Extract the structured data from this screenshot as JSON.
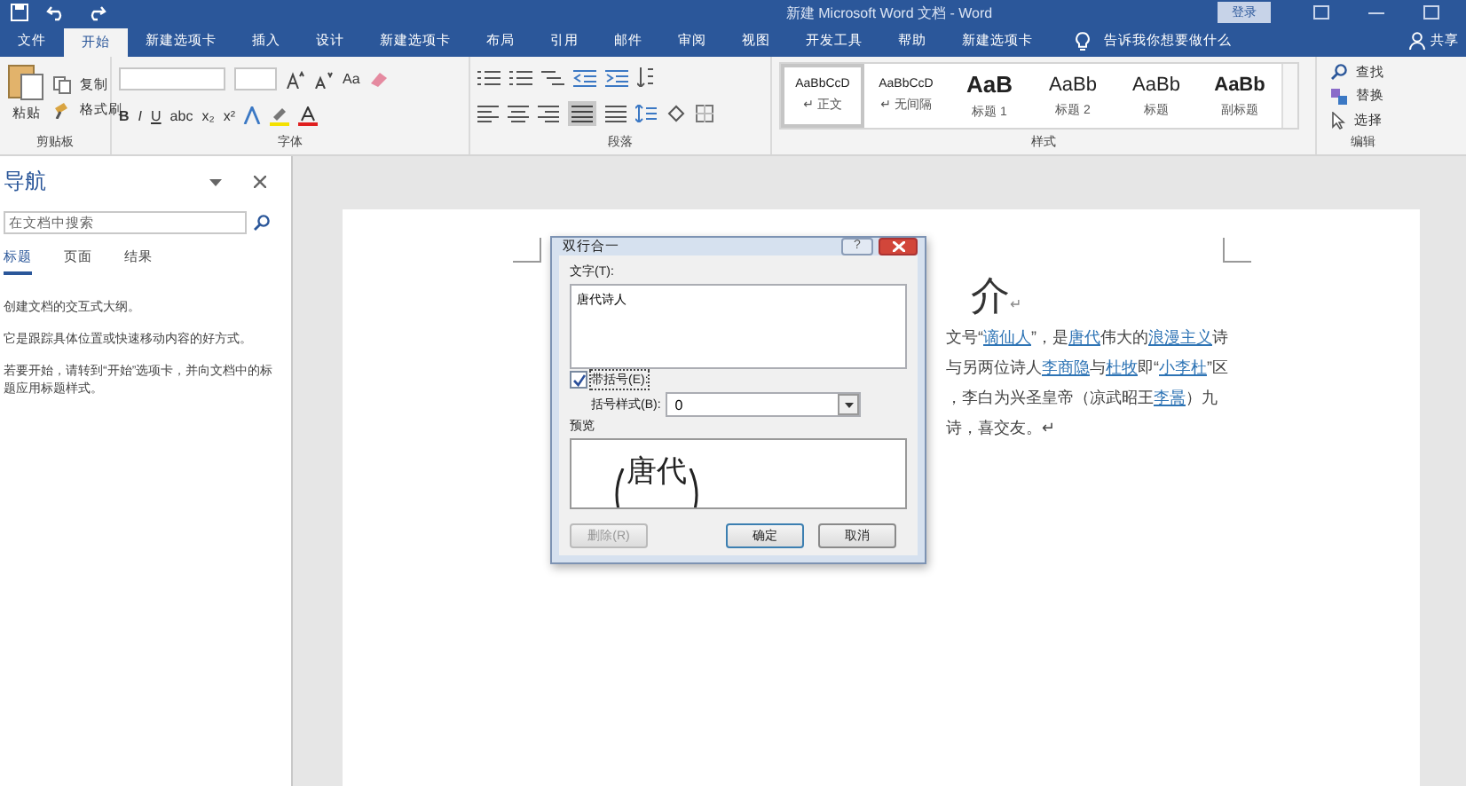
{
  "title_bar": {
    "title": "新建 Microsoft Word 文档 - Word",
    "sign_in": "登录"
  },
  "tabs": [
    {
      "label": "文件",
      "selected": false
    },
    {
      "label": "开始",
      "selected": true
    },
    {
      "label": "新建选项卡",
      "selected": false
    },
    {
      "label": "插入",
      "selected": false
    },
    {
      "label": "设计",
      "selected": false
    },
    {
      "label": "新建选项卡",
      "selected": false
    },
    {
      "label": "布局",
      "selected": false
    },
    {
      "label": "引用",
      "selected": false
    },
    {
      "label": "邮件",
      "selected": false
    },
    {
      "label": "审阅",
      "selected": false
    },
    {
      "label": "视图",
      "selected": false
    },
    {
      "label": "开发工具",
      "selected": false
    },
    {
      "label": "帮助",
      "selected": false
    },
    {
      "label": "新建选项卡",
      "selected": false
    }
  ],
  "tell_me": "告诉我你想要做什么",
  "share": "共享",
  "ribbon": {
    "clipboard": {
      "paste": "粘贴",
      "copy": "复制",
      "format_painter": "格式刷",
      "label": "剪贴板"
    },
    "font": {
      "change_case": "Aa",
      "format_buttons": [
        "B",
        "I",
        "U",
        "abc",
        "x₂",
        "x²"
      ],
      "label": "字体"
    },
    "paragraph": {
      "label": "段落"
    },
    "styles": {
      "label": "样式",
      "items": [
        {
          "preview": "AaBbCcD",
          "name": "↵ 正文",
          "kind": "normal",
          "selected": true
        },
        {
          "preview": "AaBbCcD",
          "name": "↵ 无间隔",
          "kind": "normal",
          "selected": false
        },
        {
          "preview": "AaB",
          "name": "标题 1",
          "kind": "h1",
          "selected": false
        },
        {
          "preview": "AaBb",
          "name": "标题 2",
          "kind": "h2",
          "selected": false
        },
        {
          "preview": "AaBb",
          "name": "标题",
          "kind": "title",
          "selected": false
        },
        {
          "preview": "AaBb",
          "name": "副标题",
          "kind": "subtitle",
          "selected": false
        }
      ]
    },
    "editing": {
      "find": "查找",
      "replace": "替换",
      "select": "选择",
      "label": "编辑"
    }
  },
  "nav": {
    "title": "导航",
    "search_placeholder": "在文档中搜索",
    "tabs": [
      {
        "label": "标题",
        "selected": true
      },
      {
        "label": "页面",
        "selected": false
      },
      {
        "label": "结果",
        "selected": false
      }
    ],
    "paragraphs": [
      "创建文档的交互式大纲。",
      "它是跟踪具体位置或快速移动内容的好方式。",
      "若要开始，请转到“开始”选项卡，并向文档中的标题应用标题样式。"
    ]
  },
  "document": {
    "heading": "介",
    "heading_mark": "↵",
    "lines": [
      {
        "parts": [
          {
            "text": "文号“",
            "link": false
          },
          {
            "text": "谪仙人",
            "link": true
          },
          {
            "text": "”，是",
            "link": false
          },
          {
            "text": "唐代",
            "link": true
          },
          {
            "text": "伟大的",
            "link": false
          },
          {
            "text": "浪漫主义",
            "link": true
          },
          {
            "text": "诗",
            "link": false
          }
        ]
      },
      {
        "parts": [
          {
            "text": "与另两位诗人",
            "link": false
          },
          {
            "text": "李商隐",
            "link": true
          },
          {
            "text": "与",
            "link": false
          },
          {
            "text": "杜牧",
            "link": true
          },
          {
            "text": "即“",
            "link": false
          },
          {
            "text": "小李杜",
            "link": true
          },
          {
            "text": "”区",
            "link": false
          }
        ]
      },
      {
        "parts": [
          {
            "text": "，李白为兴圣皇帝（凉武昭王",
            "link": false
          },
          {
            "text": "李暠",
            "link": true
          },
          {
            "text": "）九",
            "link": false
          }
        ]
      },
      {
        "parts": [
          {
            "text": "诗，喜交友。↵",
            "link": false
          }
        ]
      }
    ]
  },
  "dialog": {
    "title": "双行合一",
    "help": "?",
    "text_label": "文字(T):",
    "text_value": "唐代诗人",
    "bracket_label": "带括号(E):",
    "bracket_checked": true,
    "style_label": "括号样式(B):",
    "style_value": "0",
    "preview_label": "预览",
    "preview_text": "唐代",
    "buttons": [
      {
        "label": "删除(R)",
        "disabled": true,
        "kind": "plain"
      },
      {
        "label": "确定",
        "disabled": false,
        "kind": "default"
      },
      {
        "label": "取消",
        "disabled": false,
        "kind": "plain"
      }
    ]
  }
}
